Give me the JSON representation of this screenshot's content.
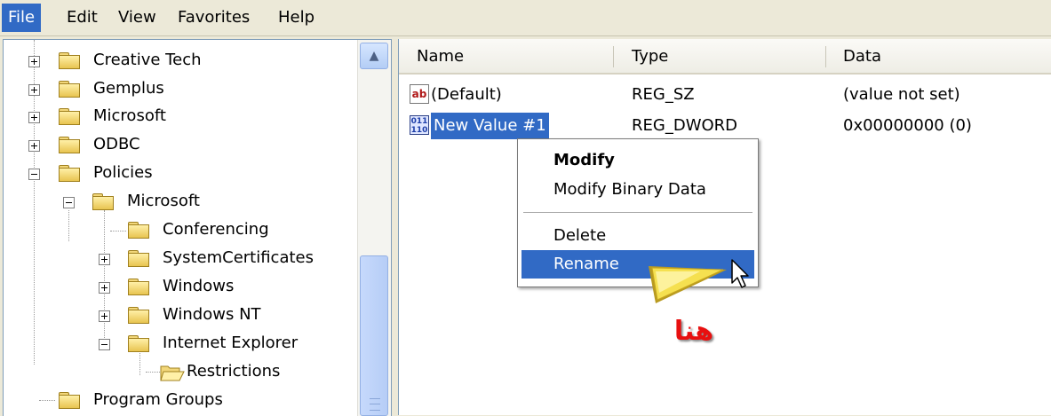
{
  "menubar": {
    "items": [
      "File",
      "Edit",
      "View",
      "Favorites",
      "Help"
    ],
    "active_index": 0
  },
  "tree": {
    "nodes": [
      {
        "label": "Creative Tech",
        "expander": "plus"
      },
      {
        "label": "Gemplus",
        "expander": "plus"
      },
      {
        "label": "Microsoft",
        "expander": "plus"
      },
      {
        "label": "ODBC",
        "expander": "plus"
      },
      {
        "label": "Policies",
        "expander": "minus"
      },
      {
        "label": "Microsoft",
        "expander": "minus"
      },
      {
        "label": "Conferencing",
        "expander": "none"
      },
      {
        "label": "SystemCertificates",
        "expander": "plus"
      },
      {
        "label": "Windows",
        "expander": "plus"
      },
      {
        "label": "Windows NT",
        "expander": "plus"
      },
      {
        "label": "Internet Explorer",
        "expander": "minus"
      },
      {
        "label": "Restrictions",
        "expander": "none",
        "open_folder": true
      },
      {
        "label": "Program Groups",
        "expander": "none"
      }
    ]
  },
  "list": {
    "columns": [
      "Name",
      "Type",
      "Data"
    ],
    "rows": [
      {
        "name": "(Default)",
        "type": "REG_SZ",
        "data": "(value not set)",
        "icon": "string-value-icon",
        "icon_text": "ab"
      },
      {
        "name": "New Value #1",
        "type": "REG_DWORD",
        "data": "0x00000000 (0)",
        "icon": "binary-value-icon",
        "icon_text": "011 110",
        "selected": true
      }
    ]
  },
  "context_menu": {
    "items": [
      {
        "label": "Modify",
        "bold": true
      },
      {
        "label": "Modify Binary Data"
      },
      {
        "label": "Delete"
      },
      {
        "label": "Rename",
        "highlighted": true
      }
    ]
  },
  "annotation": {
    "text": "هنا",
    "color": "#e81010",
    "arrow_color": "#f5e050"
  },
  "colors": {
    "selection": "#316ac5",
    "window_bg": "#ece9d8"
  }
}
